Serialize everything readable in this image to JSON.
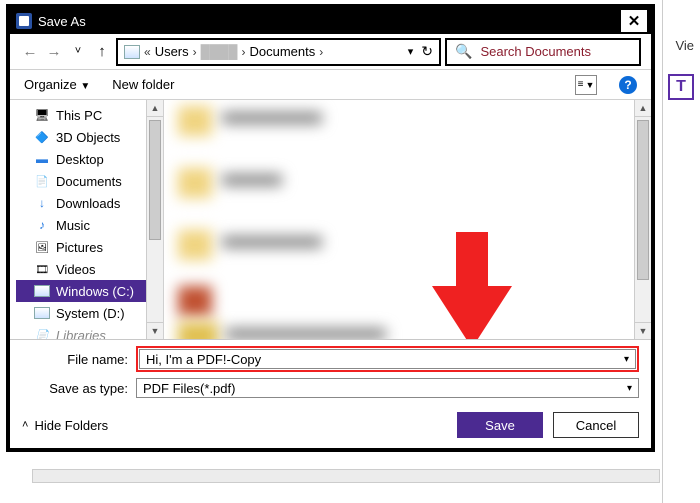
{
  "bg": {
    "vie_label": "Vie",
    "tbox_label": "T"
  },
  "titlebar": {
    "title": "Save As"
  },
  "nav": {
    "path": {
      "root_label": "Users",
      "folder_label": "Documents"
    },
    "search": {
      "placeholder": "Search Documents"
    }
  },
  "toolbar": {
    "organize_label": "Organize",
    "newfolder_label": "New folder",
    "help_label": "?"
  },
  "tree": {
    "items": [
      {
        "label": "This PC",
        "icon": "pc"
      },
      {
        "label": "3D Objects",
        "icon": "obj"
      },
      {
        "label": "Desktop",
        "icon": "desk"
      },
      {
        "label": "Documents",
        "icon": "doc"
      },
      {
        "label": "Downloads",
        "icon": "dl"
      },
      {
        "label": "Music",
        "icon": "mus"
      },
      {
        "label": "Pictures",
        "icon": "pic"
      },
      {
        "label": "Videos",
        "icon": "vid"
      },
      {
        "label": "Windows (C:)",
        "icon": "drv",
        "selected": true
      },
      {
        "label": "System (D:)",
        "icon": "drv"
      },
      {
        "label": "Libraries",
        "icon": "doc",
        "cut": true
      }
    ]
  },
  "form": {
    "filename_label": "File name:",
    "filename_value": "Hi, I'm a PDF!-Copy",
    "type_label": "Save as type:",
    "type_value": "PDF Files(*.pdf)"
  },
  "actions": {
    "hide_label": "Hide Folders",
    "save_label": "Save",
    "cancel_label": "Cancel"
  }
}
